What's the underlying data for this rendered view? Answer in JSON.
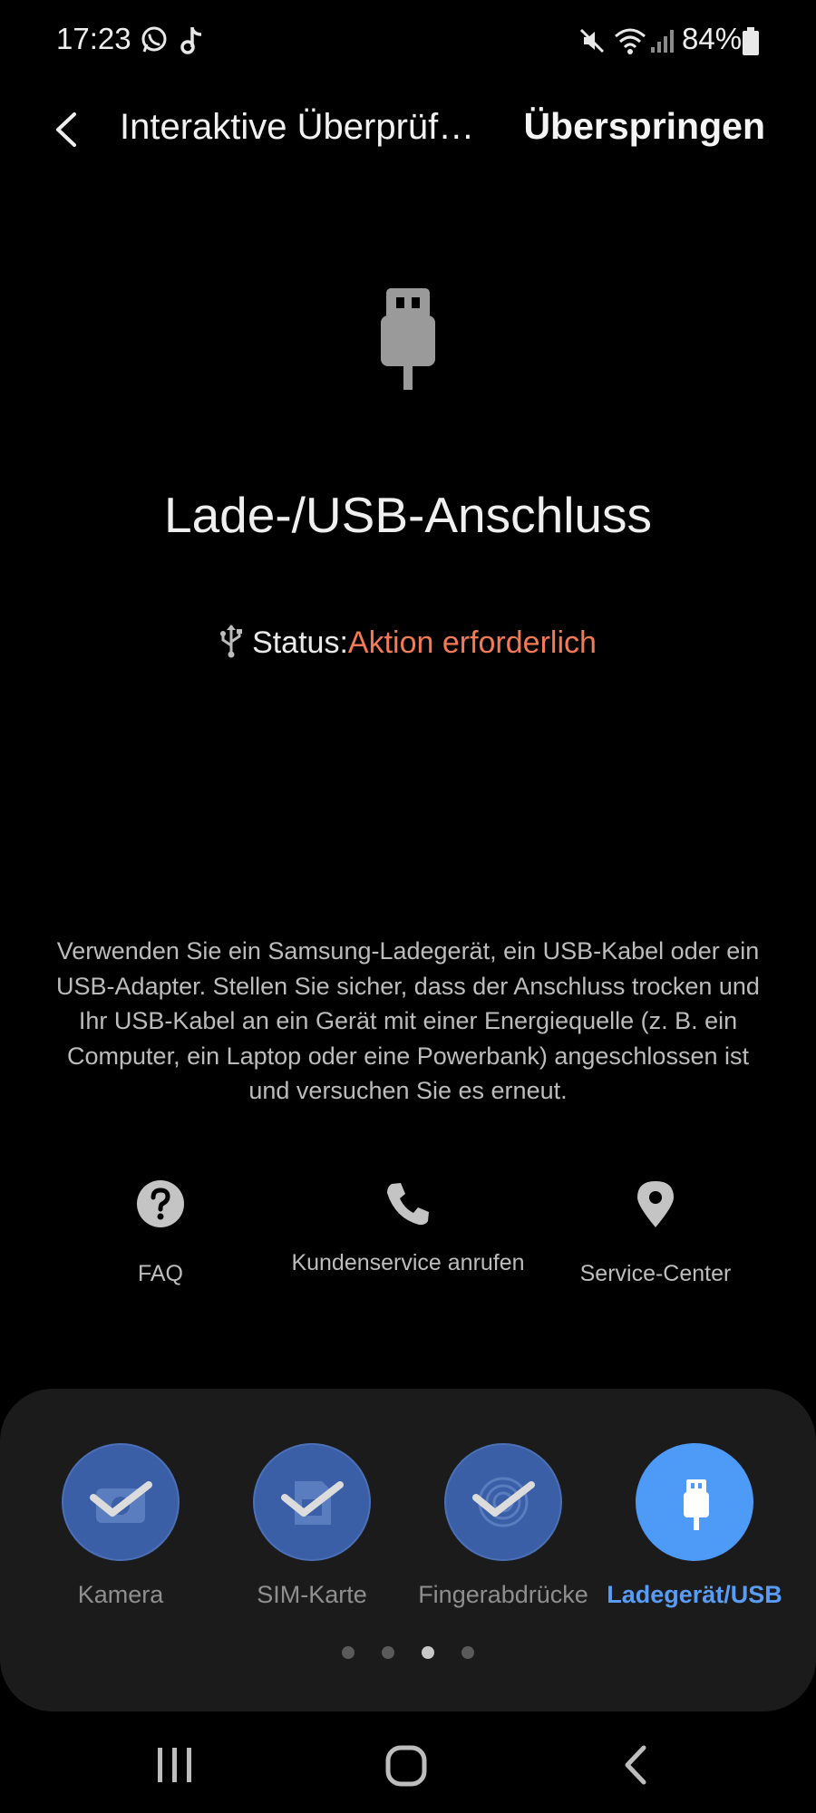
{
  "status_bar": {
    "time": "17:23",
    "icons": [
      "whatsapp-icon",
      "tiktok-icon",
      "mute-icon",
      "wifi-icon",
      "signal-icon",
      "battery-icon"
    ],
    "battery_text": "84%"
  },
  "header": {
    "title": "Interaktive Überprüf…",
    "skip_label": "Überspringen"
  },
  "hero": {
    "icon": "usb-plug-icon",
    "title": "Lade-/USB-Anschluss",
    "status_label": "Status:",
    "status_value": "Aktion erforderlich",
    "status_color": "#f47a55"
  },
  "description": "Verwenden Sie ein Samsung-Ladegerät, ein USB-Kabel oder ein USB-Adapter. Stellen Sie sicher, dass der Anschluss trocken und Ihr USB-Kabel an ein Gerät mit einer Energiequelle (z. B. ein Computer, ein Laptop oder eine Powerbank) angeschlossen ist und versuchen Sie es erneut.",
  "actions": [
    {
      "label": "FAQ",
      "icon": "help-icon"
    },
    {
      "label": "Kundenservice anrufen",
      "icon": "phone-icon"
    },
    {
      "label": "Service-Center",
      "icon": "location-pin-icon"
    }
  ],
  "steps": [
    {
      "label": "Kamera",
      "state": "done",
      "icon": "camera-icon"
    },
    {
      "label": "SIM-Karte",
      "state": "done",
      "icon": "sim-card-icon"
    },
    {
      "label": "Fingerabdrücke",
      "state": "done",
      "icon": "fingerprint-icon"
    },
    {
      "label": "Ladegerät/USB",
      "state": "active",
      "icon": "usb-plug-icon"
    }
  ],
  "pager": {
    "count": 4,
    "active_index": 2
  },
  "colors": {
    "accent": "#4d9af7",
    "step_done": "#3a5fa6",
    "status_warning": "#f47a55",
    "panel": "#1b1b1b"
  }
}
